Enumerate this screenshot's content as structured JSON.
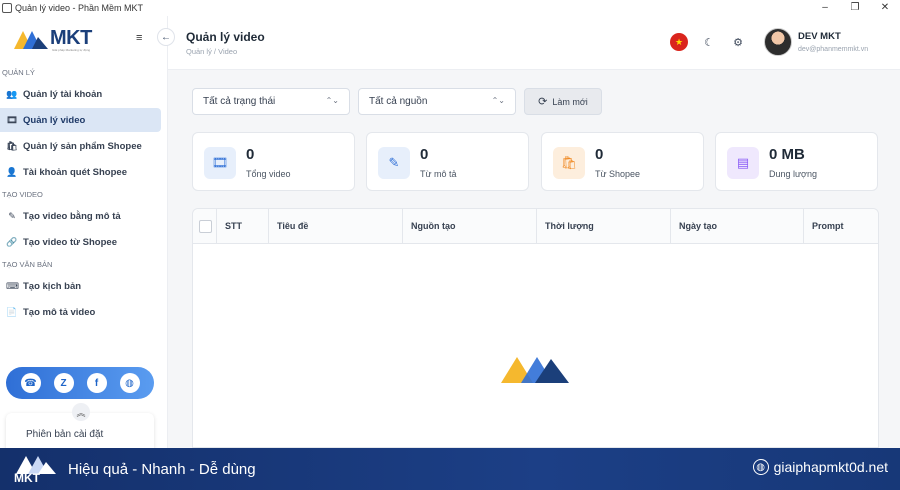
{
  "window": {
    "title": "Quản lý video - Phần Mềm MKT",
    "minimize": "–",
    "maximize": "❐",
    "close": "✕"
  },
  "sidebar": {
    "logo_text": "MKT",
    "logo_sub": "Giải pháp Marketing tự động",
    "menu_toggle": "≡",
    "collapse": "←",
    "sections": [
      {
        "label": "QUẢN LÝ"
      },
      {
        "label": "TẠO VIDEO"
      },
      {
        "label": "TẠO VĂN BẢN"
      }
    ],
    "items": [
      {
        "label": "Quản lý tài khoản",
        "icon": "users-icon",
        "glyph": "👥"
      },
      {
        "label": "Quản lý video",
        "icon": "film-icon",
        "glyph": "🎞"
      },
      {
        "label": "Quản lý sản phẩm Shopee",
        "icon": "bag-icon",
        "glyph": "🛍"
      },
      {
        "label": "Tài khoản quét Shopee",
        "icon": "user-icon",
        "glyph": "👤"
      },
      {
        "label": "Tạo video bằng mô tả",
        "icon": "pen-icon",
        "glyph": "✎"
      },
      {
        "label": "Tạo video từ Shopee",
        "icon": "link-icon",
        "glyph": "🔗"
      },
      {
        "label": "Tạo kịch bản",
        "icon": "keyboard-icon",
        "glyph": "⌨"
      },
      {
        "label": "Tạo mô tả video",
        "icon": "file-icon",
        "glyph": "📄"
      }
    ],
    "version_label": "Phiên bản cài đặt"
  },
  "header": {
    "title": "Quản lý video",
    "breadcrumb": "Quản lý / Video",
    "user_name": "DEV MKT",
    "user_email": "dev@phanmemmkt.vn"
  },
  "filters": {
    "status": "Tất cả trạng thái",
    "source": "Tất cả nguồn",
    "refresh": "Làm mới"
  },
  "stats": [
    {
      "value": "0",
      "label": "Tổng video",
      "icon": "film-icon",
      "color": "#2f6fd6",
      "bg": "#e7effb"
    },
    {
      "value": "0",
      "label": "Từ mô tả",
      "icon": "pencil-icon",
      "color": "#2f6fd6",
      "bg": "#e7effb"
    },
    {
      "value": "0",
      "label": "Từ Shopee",
      "icon": "shopping-bag-icon",
      "color": "#f08a24",
      "bg": "#fdeedd"
    },
    {
      "value": "0 MB",
      "label": "Dung lượng",
      "icon": "storage-icon",
      "color": "#8b5cf6",
      "bg": "#efe8fd"
    }
  ],
  "table": {
    "columns": [
      "STT",
      "Tiêu đề",
      "Nguồn tạo",
      "Thời lượng",
      "Ngày tạo",
      "Prompt"
    ]
  },
  "banner": {
    "logo": "MKT",
    "tagline": "Hiệu quả - Nhanh - Dễ dùng",
    "site": "giaiphapmkt0d.net"
  }
}
